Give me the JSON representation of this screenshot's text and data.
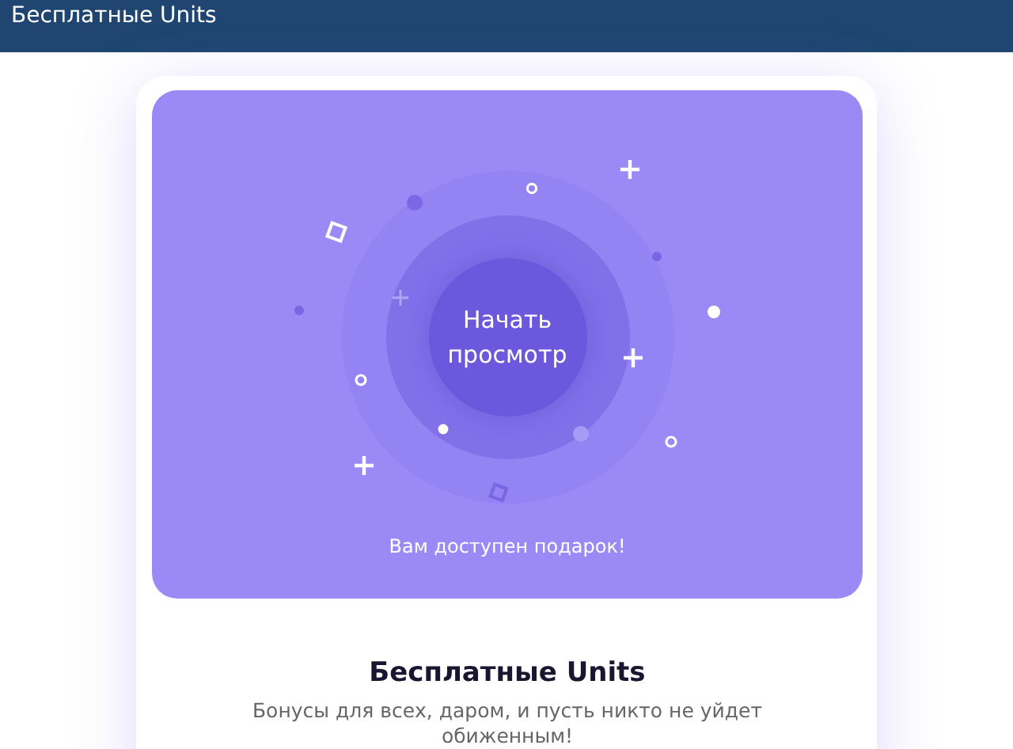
{
  "header": {
    "title": "Бесплатные Units"
  },
  "promo": {
    "button": "Начать просмотр",
    "gift_text": "Вам доступен подарок!"
  },
  "info": {
    "title": "Бесплатные Units",
    "subtitle": "Бонусы для всех, даром, и пусть никто не уйдет обиженным!"
  }
}
